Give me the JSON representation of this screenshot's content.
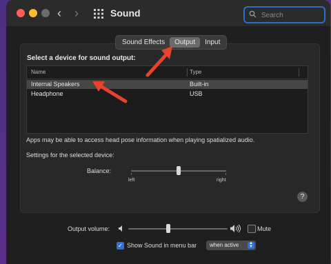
{
  "window": {
    "title": "Sound"
  },
  "search": {
    "placeholder": "Search"
  },
  "tabs": [
    {
      "label": "Sound Effects",
      "active": false
    },
    {
      "label": "Output",
      "active": true
    },
    {
      "label": "Input",
      "active": false
    }
  ],
  "output": {
    "heading": "Select a device for sound output:",
    "columns": [
      "Name",
      "Type"
    ],
    "devices": [
      {
        "name": "Internal Speakers",
        "type": "Built-in",
        "selected": true
      },
      {
        "name": "Headphone",
        "type": "USB",
        "selected": false
      }
    ],
    "note": "Apps may be able to access head pose information when playing spatialized audio.",
    "settings_label": "Settings for the selected device:",
    "balance": {
      "label": "Balance:",
      "left": "left",
      "right": "right",
      "value": 0.5
    }
  },
  "volume": {
    "label": "Output volume:",
    "value": 0.4,
    "mute_label": "Mute",
    "mute": false
  },
  "menubar": {
    "label": "Show Sound in menu bar",
    "checked": true,
    "option": "when active"
  },
  "help": "?",
  "colors": {
    "accent": "#2f6fd6",
    "annotation": "#e8412c",
    "selected_row": "#464646"
  }
}
